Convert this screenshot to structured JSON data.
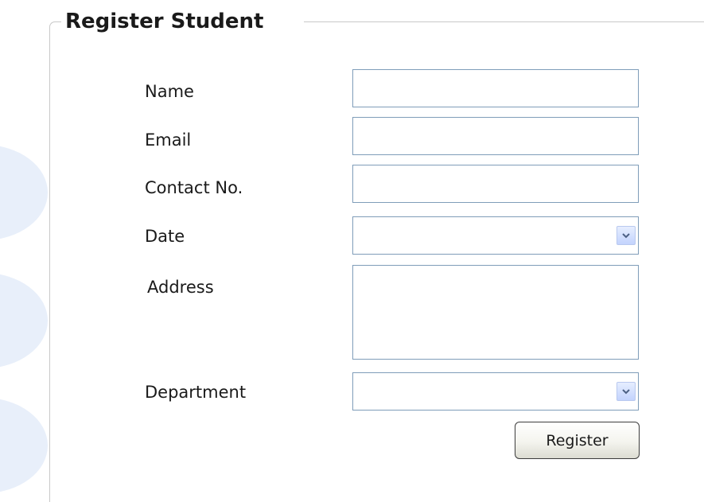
{
  "form": {
    "title": "Register Student",
    "fields": {
      "name": {
        "label": "Name",
        "value": "",
        "placeholder": ""
      },
      "email": {
        "label": "Email",
        "value": "",
        "placeholder": ""
      },
      "contact": {
        "label": "Contact No.",
        "value": "",
        "placeholder": ""
      },
      "date": {
        "label": "Date",
        "selected": ""
      },
      "address": {
        "label": "Address",
        "value": "",
        "placeholder": ""
      },
      "department": {
        "label": "Department",
        "selected": ""
      }
    },
    "submit_label": "Register"
  },
  "icons": {
    "dropdown": "chevron-down-icon"
  },
  "colors": {
    "field_border": "#7f9db9",
    "decor_circles": "#e8effa",
    "dropdown_button": "#c3d3fd"
  }
}
